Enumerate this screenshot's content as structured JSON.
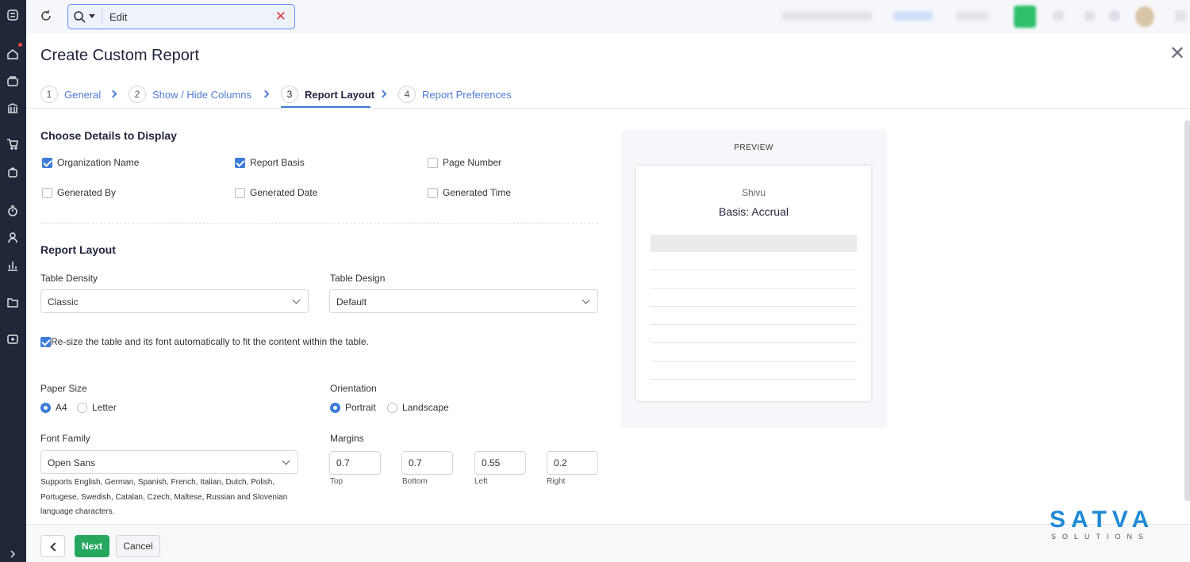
{
  "search": {
    "value": "Edit"
  },
  "dialog": {
    "title": "Create Custom Report",
    "steps": [
      {
        "num": "1",
        "label": "General"
      },
      {
        "num": "2",
        "label": "Show / Hide Columns"
      },
      {
        "num": "3",
        "label": "Report Layout"
      },
      {
        "num": "4",
        "label": "Report Preferences"
      }
    ]
  },
  "details": {
    "title": "Choose Details to Display",
    "options": [
      {
        "label": "Organization Name",
        "checked": true
      },
      {
        "label": "Report Basis",
        "checked": true
      },
      {
        "label": "Page Number",
        "checked": false
      },
      {
        "label": "Generated By",
        "checked": false
      },
      {
        "label": "Generated Date",
        "checked": false
      },
      {
        "label": "Generated Time",
        "checked": false
      }
    ]
  },
  "layout": {
    "title": "Report Layout",
    "table_density_label": "Table Density",
    "table_density_value": "Classic",
    "table_design_label": "Table Design",
    "table_design_value": "Default",
    "resize_label": "Re-size the table and its font automatically to fit the content within the table.",
    "paper_size_label": "Paper Size",
    "paper_options": [
      "A4",
      "Letter"
    ],
    "orientation_label": "Orientation",
    "orientation_options": [
      "Portrait",
      "Landscape"
    ],
    "font_family_label": "Font Family",
    "font_family_value": "Open Sans",
    "font_help": "Supports English, German, Spanish, French, Italian, Dutch, Polish, Portugese, Swedish, Catalan, Czech, Maltese, Russian and Slovenian language characters.",
    "margins_label": "Margins",
    "margins": [
      {
        "value": "0.7",
        "caption": "Top"
      },
      {
        "value": "0.7",
        "caption": "Bottom"
      },
      {
        "value": "0.55",
        "caption": "Left"
      },
      {
        "value": "0.2",
        "caption": "Right"
      }
    ]
  },
  "preview": {
    "title": "PREVIEW",
    "org": "Shivu",
    "basis": "Basis: Accrual"
  },
  "footer": {
    "next": "Next",
    "cancel": "Cancel"
  },
  "logo": {
    "big": "SATVA",
    "small": "SOLUTIONS"
  }
}
